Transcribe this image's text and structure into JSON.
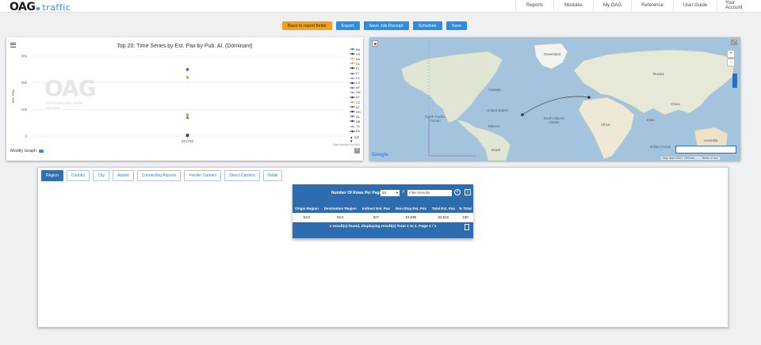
{
  "app": {
    "logo_main": "OAG",
    "logo_sub": "traffic"
  },
  "nav": [
    "Reports",
    "Modules",
    "My OAG",
    "Reference",
    "User Guide",
    "Your Account"
  ],
  "toolbar": {
    "back": "Back to report fields",
    "export": "Export",
    "save_receipt": "Save Job Receipt",
    "schedule": "Schedule",
    "save": "Save"
  },
  "chart_data": {
    "type": "scatter",
    "title": "Top 20: Time Series by Est. Pax by Pub. Al. (Dominant)",
    "xlabel": "",
    "ylabel": "Est. Pax",
    "categories": [
      "201702"
    ],
    "yticks": [
      "30k",
      "20k",
      "10k",
      "0"
    ],
    "ylim": [
      0,
      30000
    ],
    "series": [
      {
        "name": "BA",
        "values": [
          25000
        ],
        "color": "#3a7fc7",
        "marker": "circle"
      },
      {
        "name": "AA",
        "values": [
          22000
        ],
        "color": "#c9b04a",
        "marker": "circle"
      },
      {
        "name": "UA",
        "values": [
          8000
        ],
        "color": "#f0a21f",
        "marker": "circle"
      },
      {
        "name": "LH",
        "values": [
          7000
        ],
        "color": "#c0392b",
        "marker": "triangle"
      },
      {
        "name": "DL",
        "values": [
          300
        ],
        "color": "#2c3e50",
        "marker": "square"
      }
    ],
    "legend": [
      "BA",
      "VS",
      "AA",
      "DL",
      "EI",
      "FI",
      "LX",
      "LH",
      "AF",
      "SN",
      "AY",
      "LO",
      "AT",
      "OS",
      "IB",
      "AB",
      "TK",
      "EK"
    ],
    "legend_colors": [
      "#3a7fc7",
      "#2c3e50",
      "#c9b04a",
      "#f0a21f",
      "#2c3e50",
      "#3a7fc7",
      "#8e9aa6",
      "#2c3e50",
      "#3a7fc7",
      "#8e9aa6",
      "#2c3e50",
      "#f0a21f",
      "#c0392b",
      "#2c3e50",
      "#3a7fc7",
      "#2c3e50",
      "#8e9aa6",
      "#2c3e50"
    ],
    "legend_placement": "right"
  },
  "chart_ui": {
    "modify": "Modify Graph",
    "legend_pager": "1/2",
    "source_note": "Data sourced by OAG",
    "watermark_main": "OAG",
    "watermark_sub": "connecting the world of travel"
  },
  "map": {
    "labels": {
      "north_pacific": "North Pacific Ocean",
      "north_atlantic": "North Atlantic Ocean",
      "south_pacific": "South Pacific Ocean",
      "south_atlantic": "South Atlantic Ocean",
      "indian": "Indian Ocean",
      "greenland": "Greenland",
      "canada": "Canada",
      "united_states": "United States",
      "brazil": "Brazil",
      "russia": "Russia",
      "china": "China",
      "india": "India",
      "australia": "Australia",
      "africa": "Africa",
      "mexico": "Mexico"
    },
    "footer": "Map data ©2017    2000 km ——   Terms of Use",
    "google": "Google"
  },
  "tabs": [
    "Region",
    "Country",
    "City",
    "Airport",
    "Connecting Airports",
    "Feeder Carriers",
    "Direct Carriers",
    "Detail"
  ],
  "grid": {
    "rows_label": "Number Of Rows Per Page",
    "rows_value": "10",
    "filter_placeholder": "Filter Results",
    "columns": [
      "Origin Region",
      "Destination Region",
      "Indirect Est. Pax",
      "Non-Stop Est. Pax",
      "Total Est. Pax",
      "% Total"
    ],
    "rows": [
      [
        "EU1",
        "NA1",
        "927",
        "61,695",
        "62,622",
        "100"
      ]
    ],
    "footer": "1 result(s) found, displaying result(s) from 1 to 1. Page 1 / 1"
  }
}
